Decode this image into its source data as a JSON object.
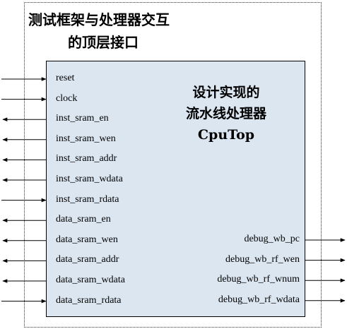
{
  "outer_module": {
    "title_line1": "测试框架与处理器交互",
    "title_line2": "的顶层接口"
  },
  "cpu_module": {
    "title_line1": "设计实现的",
    "title_line2": "流水线处理器",
    "title_line3": "CpuTop"
  },
  "left_ports": [
    {
      "label": "reset",
      "direction": "in"
    },
    {
      "label": "clock",
      "direction": "in"
    },
    {
      "label": "inst_sram_en",
      "direction": "out"
    },
    {
      "label": "inst_sram_wen",
      "direction": "out"
    },
    {
      "label": "inst_sram_addr",
      "direction": "out"
    },
    {
      "label": "inst_sram_wdata",
      "direction": "out"
    },
    {
      "label": "inst_sram_rdata",
      "direction": "in"
    },
    {
      "label": "data_sram_en",
      "direction": "out"
    },
    {
      "label": "data_sram_wen",
      "direction": "out"
    },
    {
      "label": "data_sram_addr",
      "direction": "out"
    },
    {
      "label": "data_sram_wdata",
      "direction": "out"
    },
    {
      "label": "data_sram_rdata",
      "direction": "in"
    }
  ],
  "right_ports": [
    {
      "label": "debug_wb_pc",
      "direction": "out"
    },
    {
      "label": "debug_wb_rf_wen",
      "direction": "out"
    },
    {
      "label": "debug_wb_rf_wnum",
      "direction": "out"
    },
    {
      "label": "debug_wb_rf_wdata",
      "direction": "out"
    }
  ]
}
